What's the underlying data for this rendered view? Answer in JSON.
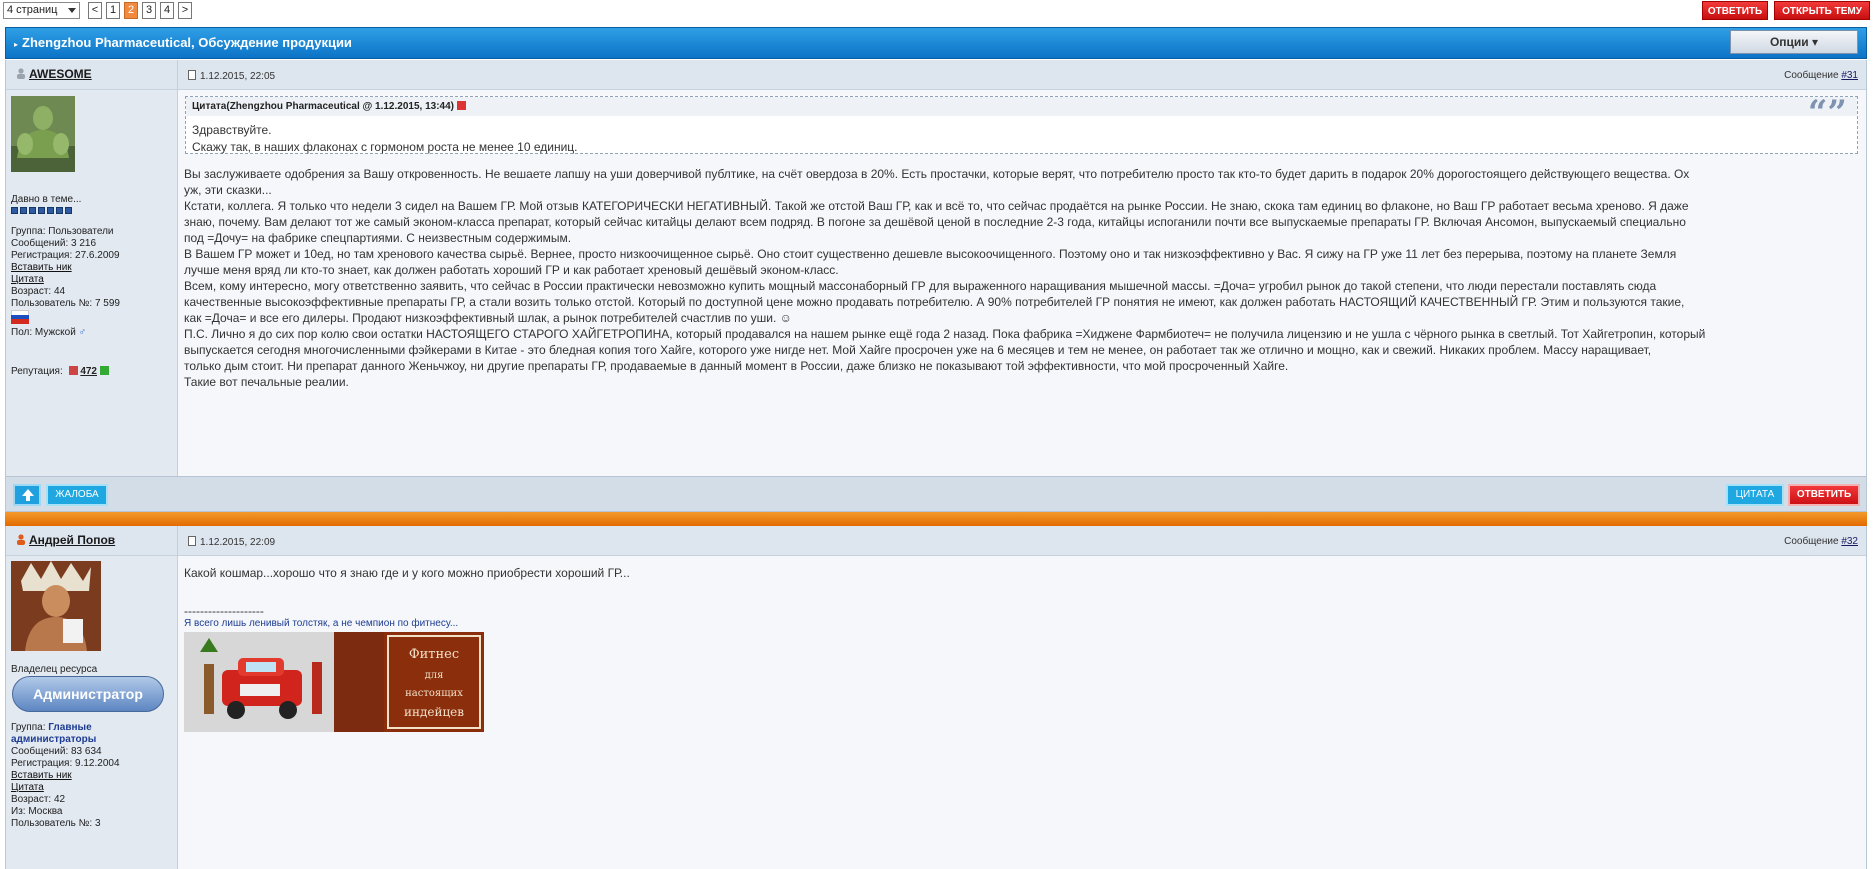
{
  "pagination": {
    "select_label": "4 страниц",
    "prev": "<",
    "pages": [
      "1",
      "2",
      "3",
      "4"
    ],
    "current": "2",
    "next": ">"
  },
  "top_buttons": {
    "reply": "ОТВЕТИТЬ",
    "new_topic": "ОТКРЫТЬ ТЕМУ"
  },
  "topic": {
    "title": "Zhengzhou Pharmaceutical, Обсуждение продукции",
    "options": "Опции"
  },
  "posts": [
    {
      "author": "AWESOME",
      "date": "1.12.2015, 22:05",
      "number_label": "Сообщение",
      "number": "#31",
      "side": {
        "since": "Давно в теме...",
        "group": "Группа: Пользователи",
        "messages": "Сообщений: 3 216",
        "registered": "Регистрация: 27.6.2009",
        "insert_nick": "Вставить ник",
        "quote": "Цитата",
        "age": "Возраст: 44",
        "user_no": "Пользователь №: 7 599",
        "gender": "Пол: Мужской",
        "rep_label": "Репутация:",
        "rep_value": "472"
      },
      "quote": {
        "header": "Цитата(Zhengzhou Pharmaceutical @ 1.12.2015, 13:44)",
        "lines": [
          "Здравствуйте.",
          "Скажу так, в наших флаконах с гормоном роста не менее 10 единиц."
        ]
      },
      "text": [
        "Вы заслуживаете одобрения за Вашу откровенность. Не вешаете лапшу на уши доверчивой публтике, на счёт овердоза в 20%. Есть простачки, которые верят, что потребителю просто так кто-то будет дарить в подарок 20% дорогостоящего действующего вещества. Ох",
        "уж, эти сказки...",
        "Кстати, коллега. Я только что недели 3 сидел на Вашем ГР. Мой отзыв КАТЕГОРИЧЕСКИ НЕГАТИВНЫЙ. Такой же отстой Ваш ГР, как и всё то, что сейчас продаётся на рынке России. Не знаю, скока там единиц во флаконе, но Ваш ГР работает весьма хреново. Я даже",
        "знаю, почему. Вам делают тот же самый эконом-класса препарат, который сейчас китайцы делают всем подряд. В погоне за дешёвой ценой в последние 2-3 года, китайцы испоганили почти все выпускаемые препараты ГР. Включая Ансомон, выпускаемый специально",
        "под =Дочу= на фабрике спецпартиями. С неизвестным содержимым.",
        "В Вашем ГР может и 10ед, но там хренового качества сырьё. Вернее, просто низкоочищенное сырьё. Оно стоит существенно дешевле высокоочищенного. Поэтому оно и так низкоэффективно у Вас. Я сижу на ГР уже 11 лет без перерыва, поэтому на планете Земля",
        "лучше меня вряд ли кто-то знает, как должен работать хороший ГР и как работает хреновый дешёвый эконом-класс.",
        "Всем, кому интересно, могу ответственно заявить, что сейчас в России практически невозможно купить мощный массонаборный ГР для выраженного наращивания мышечной массы. =Доча= угробил рынок до такой степени, что люди перестали поставлять сюда",
        "качественные высокоэффективные препараты ГР, а стали возить только отстой. Который по доступной цене можно продавать потребителю. А 90% потребителей ГР понятия не имеют, как должен работать НАСТОЯЩИЙ КАЧЕСТВЕННЫЙ ГР. Этим и пользуются такие,",
        "как =Доча= и все его дилеры. Продают низкоэффективный шлак, а рынок потребителей счастлив по уши. ☺",
        "П.С. Лично я до сих пор колю свои остатки НАСТОЯЩЕГО СТАРОГО ХАЙГЕТРОПИНА, который продавался на нашем рынке ещё года 2 назад. Пока фабрика =Хиджене Фармбиотеч= не получила лицензию и не ушла с чёрного рынка в светлый. Тот Хайгетропин, который",
        "выпускается сегодня многочисленными фэйкерами в Китае - это бледная копия того Хайге, которого уже нигде нет. Мой Хайге просрочен уже на 6 месяцев и тем не менее, он работает так же отлично и мощно, как и свежий. Никаких проблем. Массу наращивает,",
        "только дым стоит. Ни препарат данного Женьчжоу, ни другие препараты ГР, продаваемые в данный момент в России, даже близко не показывают той эффективности, что мой просроченный Хайге.",
        "Такие вот печальные реалии."
      ],
      "footer": {
        "report": "ЖАЛОБА",
        "quote": "ЦИТАТА",
        "reply": "ОТВЕТИТЬ"
      }
    },
    {
      "author": "Андрей Попов",
      "date": "1.12.2015, 22:09",
      "number_label": "Сообщение",
      "number": "#32",
      "side": {
        "owner": "Владелец ресурса",
        "badge": "Администратор",
        "group_label": "Группа:",
        "group_value": "Главные",
        "group_value2": "администраторы",
        "messages": "Сообщений: 83 634",
        "registered": "Регистрация: 9.12.2004",
        "insert_nick": "Вставить ник",
        "quote": "Цитата",
        "age": "Возраст: 42",
        "from": "Из: Москва",
        "user_no": "Пользователь №: 3"
      },
      "text": [
        "Какой кошмар...хорошо что я знаю где и у кого можно приобрести хороший ГР..."
      ],
      "signature": {
        "dashes": "--------------------",
        "motto": "Я всего лишь ленивый толстяк, а не чемпион по фитнесу...",
        "banner_text": "Фитнес для настоящих индейцев"
      }
    }
  ],
  "colors": {
    "header_blue": "#0c73c6",
    "accent_red": "#d11a1a",
    "separator_orange": "#ef8520"
  }
}
